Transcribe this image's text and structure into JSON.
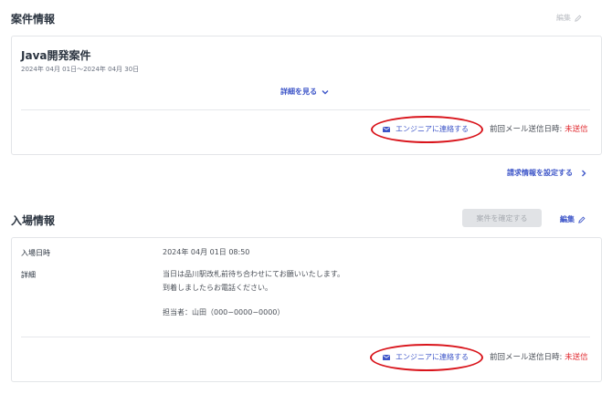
{
  "project_section": {
    "title": "案件情報",
    "edit_label": "編集",
    "card": {
      "project_name": "Java開発案件",
      "period": "2024年 04月 01日〜2024年 04月 30日",
      "details_link": "詳細を見る",
      "contact_button": "エンジニアに連絡する",
      "last_sent_label": "前回メール送信日時:",
      "last_sent_value": "未送信"
    },
    "billing_link": "請求情報を設定する"
  },
  "entry_section": {
    "title": "入場情報",
    "confirm_button": "案件を確定する",
    "edit_label": "編集",
    "card": {
      "datetime_label": "入場日時",
      "datetime_value": "2024年 04月 01日 08:50",
      "details_label": "詳細",
      "details_line1": "当日は品川駅改札前待ち合わせにてお願いいたします。",
      "details_line2": "到着しましたらお電話ください。",
      "contact_person": "担当者：山田（000−0000−0000）",
      "contact_button": "エンジニアに連絡する",
      "last_sent_label": "前回メール送信日時:",
      "last_sent_value": "未送信"
    }
  },
  "colors": {
    "link_blue": "#3d55c8",
    "unsent_red": "#e0282e",
    "highlight_ellipse": "#d9141b"
  }
}
